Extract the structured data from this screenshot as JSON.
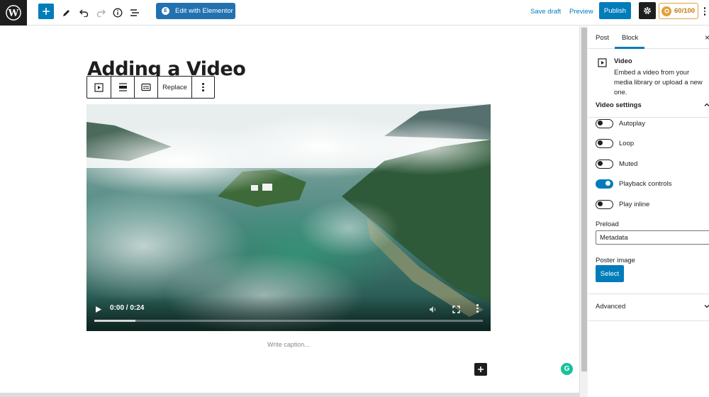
{
  "toolbar": {
    "add_icon": "plus-icon",
    "tools_icon": "pencil-icon",
    "undo_icon": "undo-icon",
    "redo_icon": "redo-icon",
    "info_icon": "info-icon",
    "outline_icon": "list-view-icon",
    "elementor_label": "Edit with Elementor",
    "save_draft": "Save draft",
    "preview": "Preview",
    "publish": "Publish",
    "settings_icon": "gear-icon",
    "score": "60/100",
    "accent": "#007cba"
  },
  "editor": {
    "title": "Adding a Video",
    "block_toolbar": {
      "replace": "Replace"
    },
    "video": {
      "time": "0:00 / 0:24",
      "progress_fraction": 0.105
    },
    "caption_placeholder": "Write caption..."
  },
  "sidebar": {
    "tabs": [
      "Post",
      "Block"
    ],
    "active_tab": "Block",
    "block": {
      "name": "Video",
      "description": "Embed a video from your media library or upload a new one."
    },
    "video_settings": {
      "title": "Video settings",
      "toggles": [
        {
          "label": "Autoplay",
          "on": false
        },
        {
          "label": "Loop",
          "on": false
        },
        {
          "label": "Muted",
          "on": false
        },
        {
          "label": "Playback controls",
          "on": true
        },
        {
          "label": "Play inline",
          "on": false
        }
      ],
      "preload_label": "Preload",
      "preload_value": "Metadata",
      "poster_label": "Poster image",
      "poster_button": "Select"
    },
    "advanced": "Advanced"
  }
}
